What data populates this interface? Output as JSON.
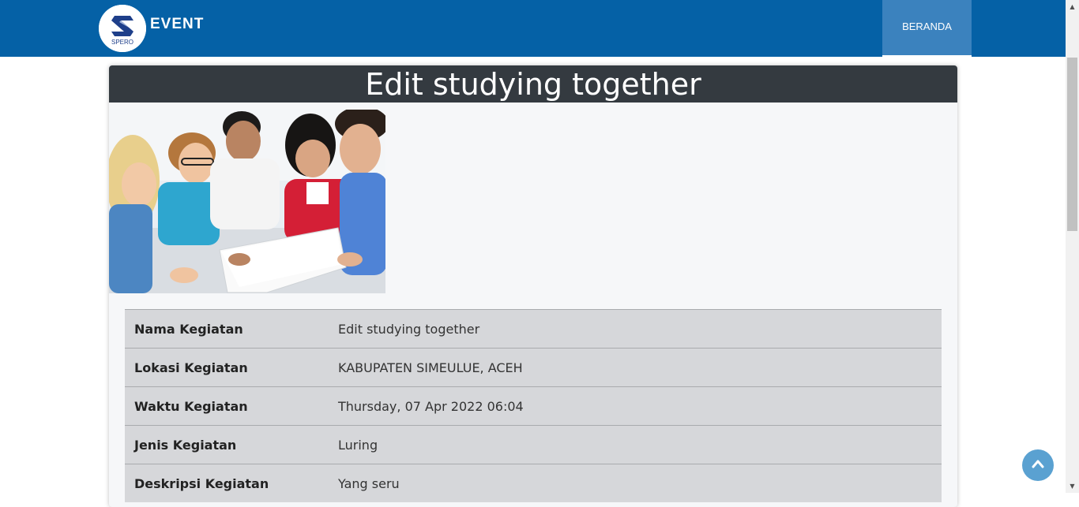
{
  "navbar": {
    "brand": "EVENT",
    "logo_text": "SPERO",
    "items": [
      {
        "label": "BERANDA"
      }
    ],
    "colors": {
      "background": "#0561a6",
      "active_item": "#3b82be"
    }
  },
  "event": {
    "header_title": "Edit studying together",
    "image_icon": "group-photo-students-laptop",
    "details": [
      {
        "label": "Nama Kegiatan",
        "value": "Edit studying together"
      },
      {
        "label": "Lokasi Kegiatan",
        "value": "KABUPATEN SIMEULUE, ACEH"
      },
      {
        "label": "Waktu Kegiatan",
        "value": "Thursday, 07 Apr 2022 06:04"
      },
      {
        "label": "Jenis Kegiatan",
        "value": "Luring"
      },
      {
        "label": "Deskripsi Kegiatan",
        "value": "Yang seru"
      }
    ]
  },
  "back_to_top": {
    "icon": "chevron-up-icon",
    "color": "#5aa1d1"
  }
}
